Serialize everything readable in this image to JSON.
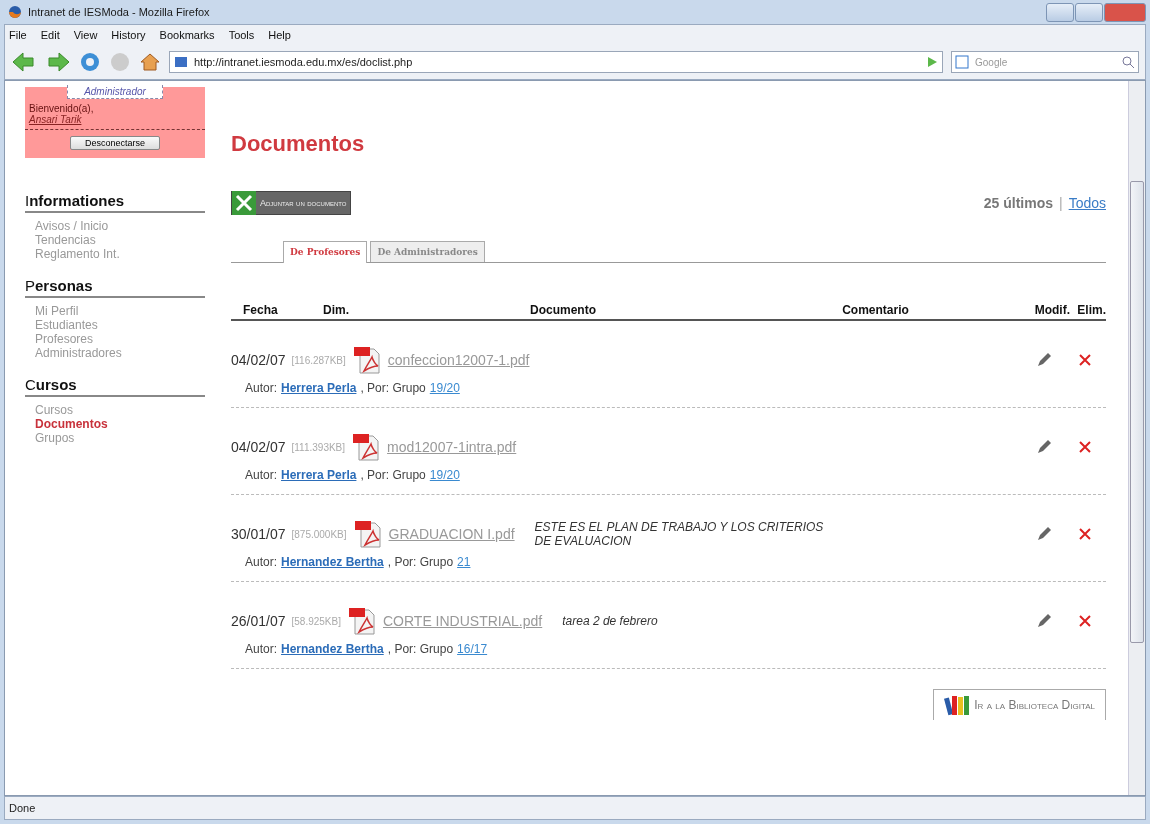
{
  "window": {
    "title": "Intranet de IESModa - Mozilla Firefox"
  },
  "menu": [
    "File",
    "Edit",
    "View",
    "History",
    "Bookmarks",
    "Tools",
    "Help"
  ],
  "address": {
    "value": "http://intranet.iesmoda.edu.mx/es/doclist.php"
  },
  "search": {
    "placeholder": "Google"
  },
  "user_box": {
    "role": "Administrador",
    "welcome": "Bienvenido(a),",
    "user": "Ansari Tarik",
    "logout": "Desconectarse"
  },
  "sidebar": [
    {
      "title": "Informationes",
      "items": [
        {
          "label": "Avisos / Inicio",
          "selected": false
        },
        {
          "label": "Tendencias",
          "selected": false
        },
        {
          "label": "Reglamento Int.",
          "selected": false
        }
      ]
    },
    {
      "title": "Personas",
      "items": [
        {
          "label": "Mi Perfil",
          "selected": false
        },
        {
          "label": "Estudiantes",
          "selected": false
        },
        {
          "label": "Profesores",
          "selected": false
        },
        {
          "label": "Administradores",
          "selected": false
        }
      ]
    },
    {
      "title": "Cursos",
      "items": [
        {
          "label": "Cursos",
          "selected": false
        },
        {
          "label": "Documentos",
          "selected": true
        },
        {
          "label": "Grupos",
          "selected": false
        }
      ]
    }
  ],
  "page_title": "Documentos",
  "upload_button": "Adjuntar un documento",
  "count": "25 últimos",
  "count_separator": "|",
  "all_link": "Todos",
  "tabs": [
    {
      "label": "De Profesores",
      "selected": true
    },
    {
      "label": "De Administradores",
      "selected": false
    }
  ],
  "columns": [
    "Fecha",
    "Dim.",
    "Documento",
    "Comentario",
    "Modif.",
    "Elim."
  ],
  "rows": [
    {
      "date": "04/02/07",
      "size": "[116.287KB]",
      "file": "confeccion12007-1.pdf",
      "comment": "",
      "author_label": "Autor:",
      "author": "Herrera Perla",
      "by": ", Por: Grupo",
      "group": "19/20"
    },
    {
      "date": "04/02/07",
      "size": "[111.393KB]",
      "file": "mod12007-1intra.pdf",
      "comment": "",
      "author_label": "Autor:",
      "author": "Herrera Perla",
      "by": ", Por: Grupo",
      "group": "19/20"
    },
    {
      "date": "30/01/07",
      "size": "[875.000KB]",
      "file": "GRADUACION I.pdf",
      "comment": "ESTE ES EL PLAN DE TRABAJO Y LOS CRITERIOS DE EVALUACION",
      "author_label": "Autor:",
      "author": "Hernandez Bertha",
      "by": ", Por: Grupo",
      "group": "21"
    },
    {
      "date": "26/01/07",
      "size": "[58.925KB]",
      "file": "CORTE INDUSTRIAL.pdf",
      "comment": "tarea 2 de febrero",
      "author_label": "Autor:",
      "author": "Hernandez Bertha",
      "by": ", Por: Grupo",
      "group": "16/17"
    }
  ],
  "library_button": "Ir a la Biblioteca Digital",
  "status_bar": "Done"
}
